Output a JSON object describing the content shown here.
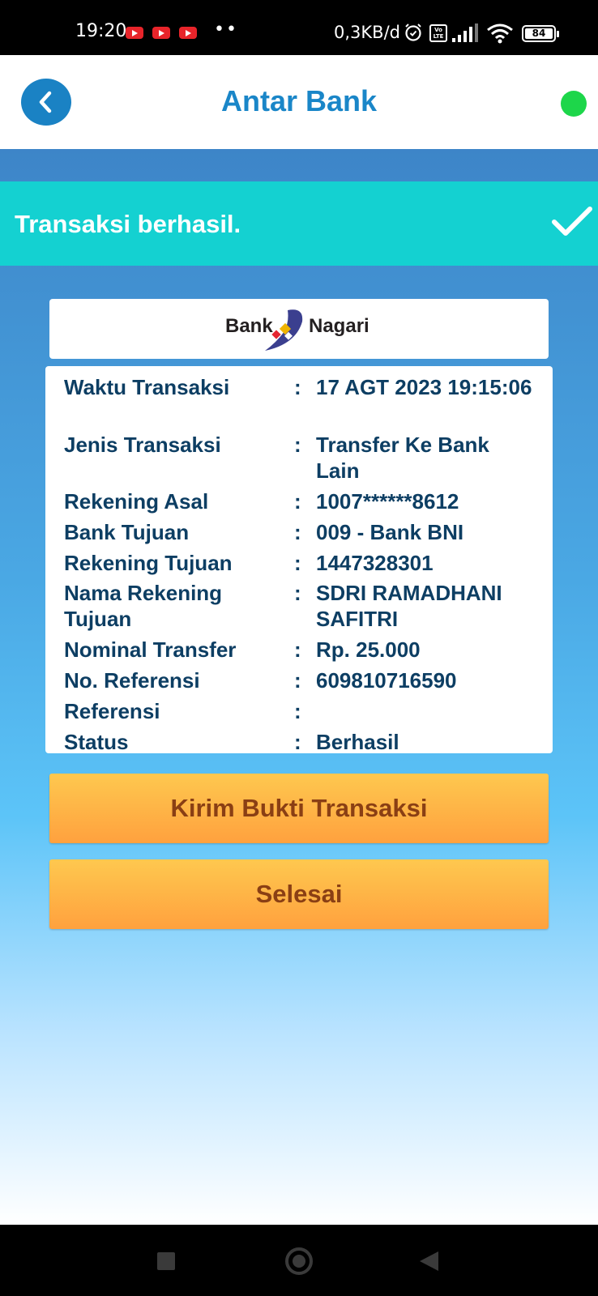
{
  "status_bar": {
    "time": "19:20",
    "dots": "••",
    "network_speed": "0,3KB/d",
    "volte": "Vo\nLTE",
    "battery": "84"
  },
  "header": {
    "title": "Antar Bank",
    "status_color": "#1dd64a"
  },
  "banner": {
    "message": "Transaksi berhasil."
  },
  "logo": {
    "left": "Bank",
    "right": "Nagari"
  },
  "details": [
    {
      "label": "Waktu Transaksi",
      "value": "17 AGT 2023 19:15:06"
    },
    {
      "label": "Jenis Transaksi",
      "value": "Transfer Ke Bank Lain"
    },
    {
      "label": "Rekening Asal",
      "value": "1007******8612"
    },
    {
      "label": "Bank Tujuan",
      "value": "009 - Bank BNI"
    },
    {
      "label": "Rekening Tujuan",
      "value": "1447328301"
    },
    {
      "label": "Nama Rekening Tujuan",
      "value": "SDRI RAMADHANI SAFITRI"
    },
    {
      "label": "Nominal Transfer",
      "value": "Rp. 25.000"
    },
    {
      "label": "No. Referensi",
      "value": "609810716590"
    },
    {
      "label": "Referensi",
      "value": ""
    },
    {
      "label": "Status",
      "value": "Berhasil"
    }
  ],
  "separator": ":",
  "buttons": {
    "send_receipt": "Kirim Bukti Transaksi",
    "done": "Selesai"
  },
  "colors": {
    "accent": "#1a86c8",
    "success_banner": "#14d1d1",
    "button": "#ffa13e",
    "button_text": "#8a3f14",
    "detail_text": "#0d3e63"
  }
}
